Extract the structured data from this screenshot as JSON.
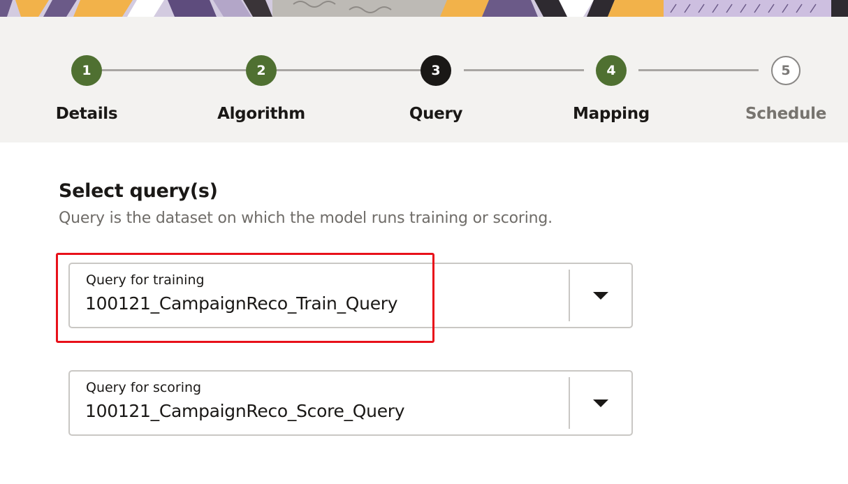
{
  "stepper": {
    "steps": [
      {
        "number": "1",
        "label": "Details",
        "state": "complete"
      },
      {
        "number": "2",
        "label": "Algorithm",
        "state": "complete"
      },
      {
        "number": "3",
        "label": "Query",
        "state": "current"
      },
      {
        "number": "4",
        "label": "Mapping",
        "state": "complete"
      },
      {
        "number": "5",
        "label": "Schedule",
        "state": "todo"
      }
    ]
  },
  "section": {
    "title": "Select query(s)",
    "description": "Query is the dataset on which the model runs training or scoring."
  },
  "training_select": {
    "label": "Query for training",
    "value": "100121_CampaignReco_Train_Query"
  },
  "scoring_select": {
    "label": "Query for scoring",
    "value": "100121_CampaignReco_Score_Query"
  },
  "colors": {
    "complete": "#4f7031",
    "current": "#1a1816",
    "highlight": "#e8111a",
    "stepper_bg": "#f3f2f0"
  }
}
